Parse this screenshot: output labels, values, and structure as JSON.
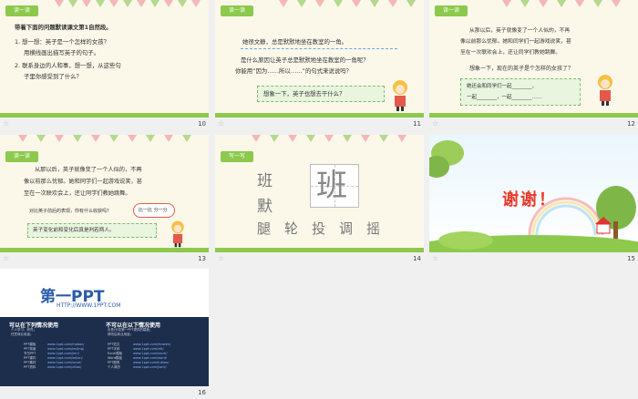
{
  "slides": [
    {
      "num": "10",
      "tag": "读一读",
      "lines": [
        "带着下面的问题默读课文第1自然段。",
        "1. 想一想：英子是一个怎样的女孩？",
        "用横线画出描写英子的句子。",
        "2. 联系身边的人和事，想一想，从这些句",
        "子里你感受到了什么？"
      ]
    },
    {
      "num": "11",
      "tag": "读一读",
      "lines": [
        "她很文静，总是默默地坐在教室的一角。",
        "是什么原因让英子总是默默地坐在教室的一角呢？",
        "你能用“因为……所以……”的句式来说说吗？"
      ],
      "box": "想象一下，英子也想去干什么？"
    },
    {
      "num": "12",
      "tag": "读一读",
      "lines": [
        "从那以后，英子就像变了一个人似的，不再",
        "像以前那么忧郁。她和同学们一起游戏说笑，甚",
        "至在一次联欢会上，还让同学们教她跳舞。",
        "想象一下，现在的英子是个怎样的女孩了？"
      ],
      "box1": "她还会和同学们一起________，",
      "box2": "一起________，一起________……"
    },
    {
      "num": "13",
      "tag": "读一读",
      "lines": [
        "从那以后，英子就像变了一个人似的，不再",
        "像以前那么忧郁。她和同学们一起游戏说笑，甚",
        "至在一次联欢会上，还让同学们教她跳舞。",
        "对比英子前后的表现，你有什么收获吗？"
      ],
      "bubble": "比一比 分一分",
      "box": "英子变化前和变化后真是判若两人。"
    },
    {
      "num": "14",
      "tag": "写一写",
      "chars": [
        "班",
        "默",
        "腿",
        "轮",
        "投",
        "调",
        "摇"
      ],
      "big": "班"
    },
    {
      "num": "15",
      "thanks": "谢谢！"
    },
    {
      "num": "16",
      "logo": "第一PPT",
      "url": "HTTP://WWW.1PPT.COM",
      "h1": "可以在下列情况使用",
      "h2": "不可以在以下情况使用",
      "s1": [
        "个人学习、研究；",
        "任意商业用途；"
      ],
      "s2": [
        "出售/分发第一PPT提供的模板；",
        "修改后商业用途；"
      ],
      "links": [
        "www.1ppt.com/moban/",
        "www.1ppt.com/beijing/",
        "www.1ppt.com/jieri/",
        "www.1ppt.com/kejian/",
        "www.1ppt.com/sucai/",
        "www.1ppt.com/ziliao/"
      ],
      "links2": [
        "www.1ppt.com/fanwen/",
        "www.1ppt.com/ziti/",
        "www.1ppt.com/excel/",
        "www.1ppt.com/word/",
        "www.1ppt.com/tubiao/",
        "www.1ppt.com/jianli/"
      ],
      "left_labels": [
        "PPT模板",
        "PPT背景",
        "节日PPT",
        "PPT课件",
        "PPT素材",
        "PPT资料"
      ],
      "right_labels": [
        "PPT范文",
        "PPT字体",
        "Excel模板",
        "Word模板",
        "PPT图表",
        "个人简历"
      ]
    }
  ],
  "colors": {
    "accent": "#8cc94c",
    "text": "#333333",
    "brand": "#2a5ba8"
  }
}
